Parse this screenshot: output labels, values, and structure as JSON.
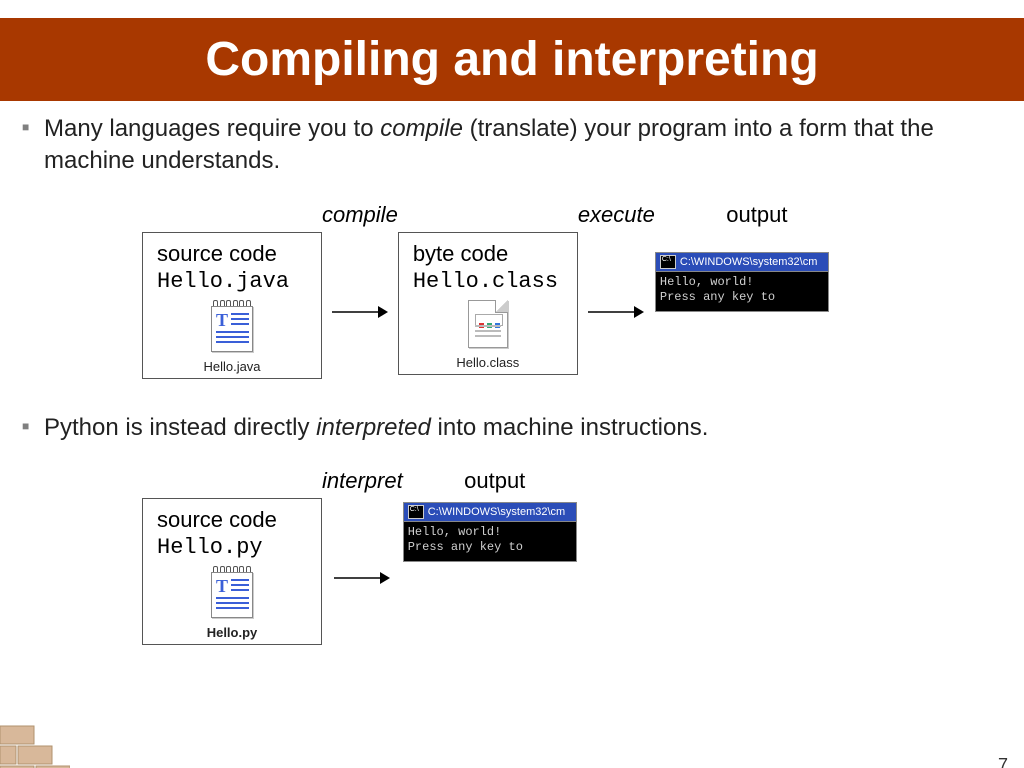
{
  "title": "Compiling and interpreting",
  "bullet1_prefix": "Many languages require you to ",
  "bullet1_italic": "compile",
  "bullet1_suffix": " (translate) your program into a form that the machine understands.",
  "bullet2_prefix": "Python is instead directly ",
  "bullet2_italic": "interpreted",
  "bullet2_suffix": " into machine instructions.",
  "labels": {
    "compile": "compile",
    "execute": "execute",
    "interpret": "interpret",
    "source_code": "source code",
    "byte_code": "byte code",
    "output": "output"
  },
  "java": {
    "source_file": "Hello.java",
    "source_caption": "Hello.java",
    "class_file": "Hello.class",
    "class_caption": "Hello.class"
  },
  "python": {
    "source_file": "Hello.py",
    "source_caption": "Hello.py"
  },
  "terminal": {
    "title": "C:\\WINDOWS\\system32\\cm",
    "line1": "Hello, world!",
    "line2": "Press any key to"
  },
  "page_number": "7"
}
